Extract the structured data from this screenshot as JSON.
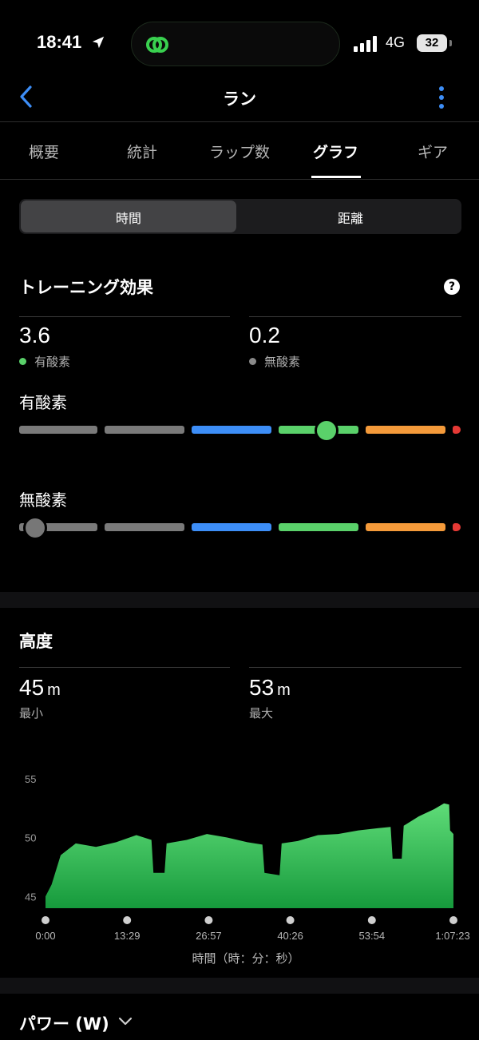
{
  "status": {
    "time": "18:41",
    "network": "4G",
    "battery": "32"
  },
  "nav": {
    "title": "ラン"
  },
  "tabs": [
    {
      "label": "概要"
    },
    {
      "label": "統計"
    },
    {
      "label": "ラップ数"
    },
    {
      "label": "グラフ"
    },
    {
      "label": "ギア"
    }
  ],
  "active_tab": 3,
  "segmented": {
    "options": [
      "時間",
      "距離"
    ],
    "selected": 0
  },
  "training_effect": {
    "title": "トレーニング効果",
    "aerobic": {
      "value": "3.6",
      "label": "有酸素"
    },
    "anaerobic": {
      "value": "0.2",
      "label": "無酸素"
    },
    "aerobic_bar_label": "有酸素",
    "anaerobic_bar_label": "無酸素",
    "aerobic_level": 3.6,
    "anaerobic_level": 0.2,
    "colors": {
      "aerobic": "#5ad16a",
      "anaerobic": "#8a8a8a"
    }
  },
  "elevation": {
    "title": "高度",
    "min": {
      "value": "45",
      "unit": "m",
      "label": "最小"
    },
    "max": {
      "value": "53",
      "unit": "m",
      "label": "最大"
    }
  },
  "chart_data": {
    "type": "area",
    "title": "高度",
    "xlabel": "時間（時：分：秒）",
    "ylabel": "",
    "y_ticks": [
      "55",
      "50",
      "45"
    ],
    "x_ticks": [
      "0:00",
      "13:29",
      "26:57",
      "40:26",
      "53:54",
      "1:07:23"
    ],
    "ylim": [
      44,
      56
    ],
    "xlim_seconds": [
      0,
      4043
    ],
    "series": [
      {
        "values": [
          [
            0,
            45
          ],
          [
            60,
            46
          ],
          [
            150,
            48.5
          ],
          [
            300,
            49.5
          ],
          [
            500,
            49.2
          ],
          [
            700,
            49.6
          ],
          [
            900,
            50.2
          ],
          [
            1050,
            49.8
          ],
          [
            1070,
            47.0
          ],
          [
            1180,
            47.0
          ],
          [
            1200,
            49.5
          ],
          [
            1400,
            49.8
          ],
          [
            1600,
            50.3
          ],
          [
            1800,
            50.0
          ],
          [
            2000,
            49.6
          ],
          [
            2150,
            49.4
          ],
          [
            2170,
            47.0
          ],
          [
            2320,
            46.8
          ],
          [
            2340,
            49.5
          ],
          [
            2500,
            49.7
          ],
          [
            2700,
            50.2
          ],
          [
            2900,
            50.3
          ],
          [
            3100,
            50.6
          ],
          [
            3300,
            50.8
          ],
          [
            3420,
            50.9
          ],
          [
            3440,
            48.2
          ],
          [
            3530,
            48.2
          ],
          [
            3550,
            51.0
          ],
          [
            3700,
            51.8
          ],
          [
            3850,
            52.4
          ],
          [
            3950,
            52.9
          ],
          [
            4000,
            52.8
          ],
          [
            4010,
            50.6
          ],
          [
            4043,
            50.3
          ]
        ],
        "color": "#3dbb58"
      }
    ]
  },
  "power": {
    "label": "パワー (W)"
  }
}
